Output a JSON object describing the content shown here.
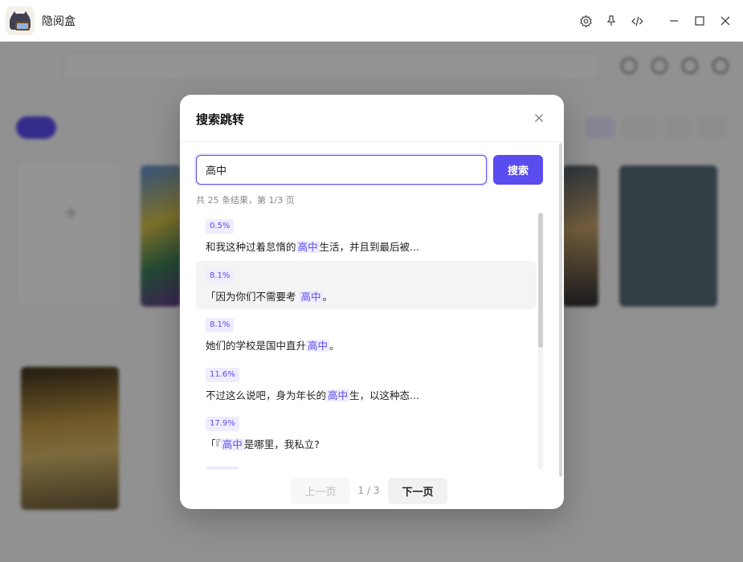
{
  "window": {
    "title": "隐阅盒"
  },
  "colors": {
    "accent": "#5b4cf0",
    "highlight_bg": "#eeecfd"
  },
  "dialog": {
    "title": "搜索跳转",
    "query": "高中",
    "search_button": "搜索",
    "summary": "共 25 条结果，第 1/3 页",
    "results": [
      {
        "percent": "0.5%",
        "before": "和我这种过着怠惰的",
        "match": "高中",
        "after": "生活，并且到最后被..."
      },
      {
        "percent": "8.1%",
        "before": "「因为你们不需要考 ",
        "match": "高中",
        "after": "。"
      },
      {
        "percent": "8.1%",
        "before": "她们的学校是国中直升",
        "match": "高中",
        "after": "。"
      },
      {
        "percent": "11.6%",
        "before": "不过这么说吧，身为年长的",
        "match": "高中",
        "after": "生，以这种态..."
      },
      {
        "percent": "17.9%",
        "before": "「『",
        "match": "高中",
        "after": "是哪里，我私立?"
      }
    ],
    "prev_button": "上一页",
    "next_button": "下一页",
    "page_indicator": "1 / 3"
  }
}
